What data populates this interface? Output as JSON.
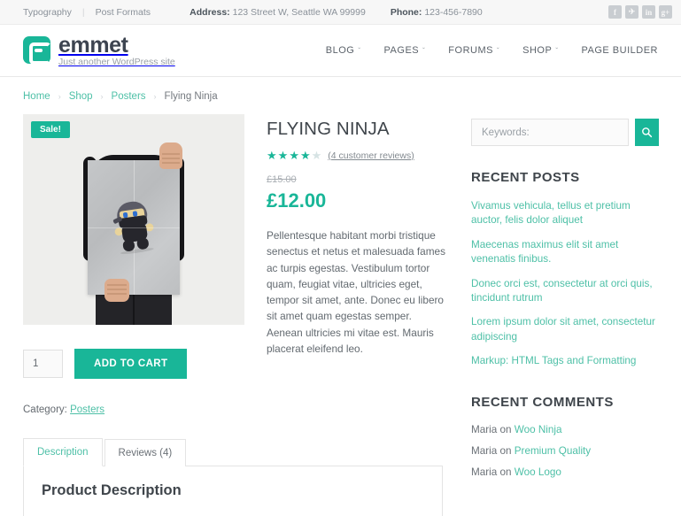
{
  "topbar": {
    "links": [
      {
        "label": "Typography"
      },
      {
        "label": "Post Formats"
      }
    ],
    "separator": "|",
    "address_label": "Address:",
    "address_value": "123 Street W, Seattle WA 99999",
    "phone_label": "Phone:",
    "phone_value": "123-456-7890",
    "social": [
      {
        "name": "facebook-icon",
        "glyph": "f"
      },
      {
        "name": "twitter-icon",
        "glyph": "✈"
      },
      {
        "name": "linkedin-icon",
        "glyph": "in"
      },
      {
        "name": "googleplus-icon",
        "glyph": "g+"
      }
    ]
  },
  "header": {
    "brand_name": "emmet",
    "brand_tagline": "Just another WordPress site",
    "nav": [
      {
        "label": "BLOG",
        "caret": "ˇ"
      },
      {
        "label": "PAGES",
        "caret": "ˇ"
      },
      {
        "label": "FORUMS",
        "caret": "ˇ"
      },
      {
        "label": "SHOP",
        "caret": "ˇ"
      },
      {
        "label": "PAGE BUILDER",
        "caret": ""
      }
    ]
  },
  "breadcrumb": {
    "items": [
      {
        "label": "Home",
        "link": true
      },
      {
        "label": "Shop",
        "link": true
      },
      {
        "label": "Posters",
        "link": true
      },
      {
        "label": "Flying Ninja",
        "link": false
      }
    ],
    "separator": "›"
  },
  "product": {
    "sale_badge": "Sale!",
    "title": "FLYING NINJA",
    "rating": 4,
    "rating_max": 5,
    "reviews_text": "(4 customer reviews)",
    "old_price": "£15.00",
    "new_price": "£12.00",
    "description": "Pellentesque habitant morbi tristique senectus et netus et malesuada fames ac turpis egestas. Vestibulum tortor quam, feugiat vitae, ultricies eget, tempor sit amet, ante. Donec eu libero sit amet quam egestas semper. Aenean ultricies mi vitae est. Mauris placerat eleifend leo.",
    "quantity": "1",
    "add_to_cart_label": "ADD TO CART",
    "category_label": "Category:",
    "category_value": "Posters"
  },
  "tabs": {
    "items": [
      {
        "label": "Description",
        "active": true
      },
      {
        "label": "Reviews (4)",
        "active": false
      }
    ],
    "panel_title": "Product Description"
  },
  "sidebar": {
    "search_placeholder": "Keywords:",
    "search_value": "",
    "search_icon": "search-icon",
    "recent_posts_title": "RECENT POSTS",
    "recent_posts": [
      "Vivamus vehicula, tellus et pretium auctor, felis dolor aliquet",
      "Maecenas maximus elit sit amet venenatis finibus.",
      "Donec orci est, consectetur at orci quis, tincidunt rutrum",
      "Lorem ipsum dolor sit amet, consectetur adipiscing",
      "Markup: HTML Tags and Formatting"
    ],
    "recent_comments_title": "RECENT COMMENTS",
    "recent_comments": [
      {
        "author": "Maria",
        "on": "on",
        "post": "Woo Ninja"
      },
      {
        "author": "Maria",
        "on": "on",
        "post": "Premium Quality"
      },
      {
        "author": "Maria",
        "on": "on",
        "post": "Woo Logo"
      }
    ]
  },
  "colors": {
    "accent": "#19b698",
    "link": "#4ec0a7",
    "text": "#5a6268",
    "heading": "#3f454b"
  }
}
